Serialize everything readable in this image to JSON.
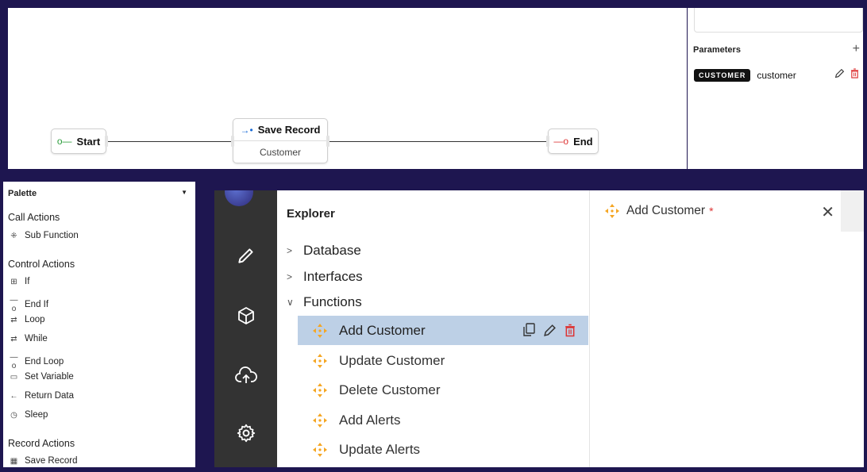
{
  "flow": {
    "start_label": "Start",
    "save_title": "Save Record",
    "save_subtitle": "Customer",
    "end_label": "End"
  },
  "parameters": {
    "heading": "Parameters",
    "add_label": "+",
    "items": [
      {
        "type": "CUSTOMER",
        "name": "customer"
      }
    ]
  },
  "palette": {
    "title": "Palette",
    "sections": [
      {
        "label": "Call Actions",
        "items": [
          "Sub Function"
        ]
      },
      {
        "label": "Control Actions",
        "items": [
          "If",
          "End If",
          "Loop",
          "While",
          "End Loop",
          "Set Variable",
          "Return Data",
          "Sleep"
        ]
      },
      {
        "label": "Record Actions",
        "items": [
          "Save Record"
        ]
      }
    ]
  },
  "explorer": {
    "title": "Explorer",
    "folders": [
      "Database",
      "Interfaces",
      "Functions"
    ],
    "functions": [
      "Add Customer",
      "Update Customer",
      "Delete Customer",
      "Add Alerts",
      "Update Alerts"
    ]
  },
  "editor": {
    "tab_label": "Add Customer",
    "dirty_marker": "*",
    "close_glyph": "✕"
  },
  "colors": {
    "background": "#1e1650",
    "function_icon": "#f5a623",
    "selected_row": "#bdd0e6",
    "delete": "#dd3333"
  }
}
